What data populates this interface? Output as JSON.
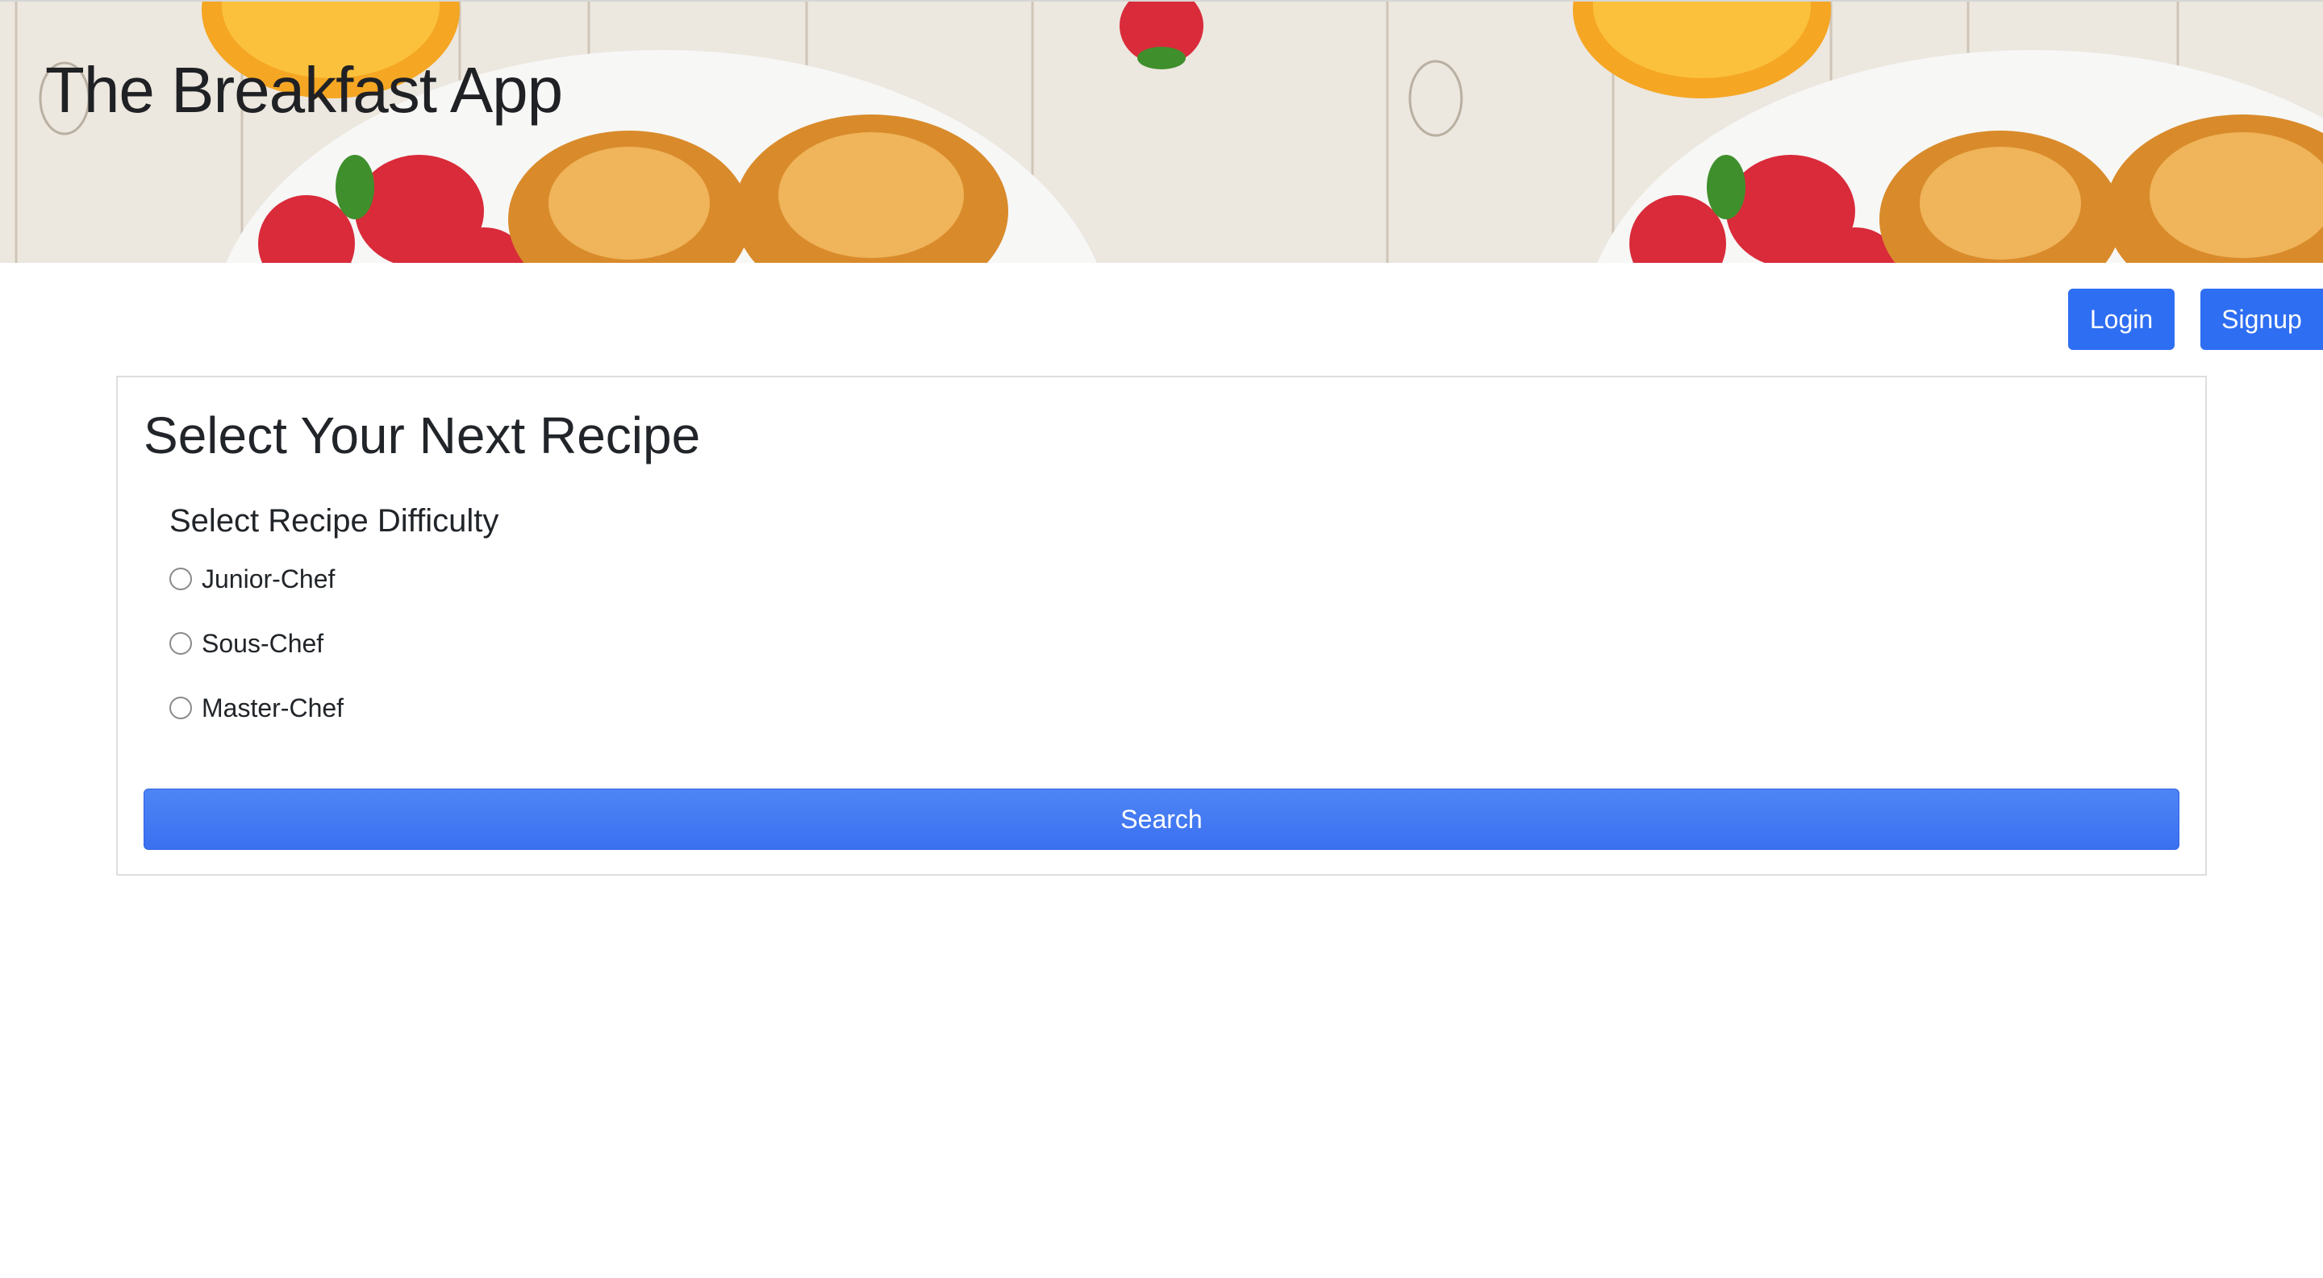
{
  "header": {
    "title": "The Breakfast App",
    "banner_image": "breakfast-croissants-strawberries-oranges-photo"
  },
  "auth": {
    "login_label": "Login",
    "signup_label": "Signup"
  },
  "recipe_form": {
    "title": "Select Your Next Recipe",
    "difficulty_heading": "Select Recipe Difficulty",
    "options": [
      {
        "label": "Junior-Chef",
        "selected": false
      },
      {
        "label": "Sous-Chef",
        "selected": false
      },
      {
        "label": "Master-Chef",
        "selected": false
      }
    ],
    "search_label": "Search"
  },
  "colors": {
    "primary": "#2e6ef2",
    "text": "#212529",
    "card_border": "#dedede"
  }
}
